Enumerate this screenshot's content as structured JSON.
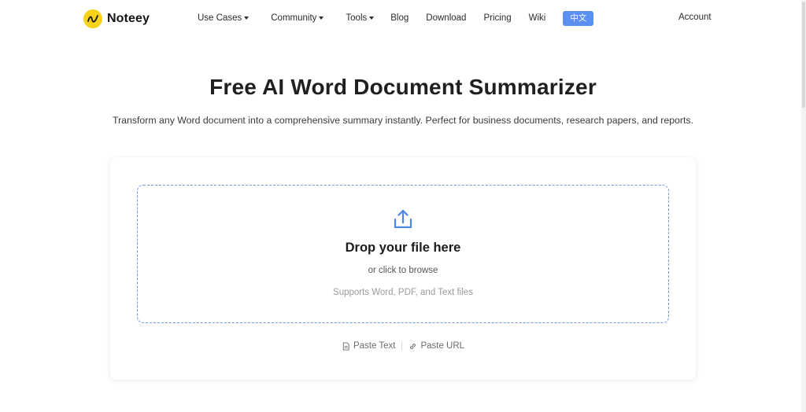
{
  "brand": {
    "name": "Noteey",
    "icon": "noteey-logo-icon",
    "color": "#f7d21a"
  },
  "nav": {
    "items": [
      {
        "label": "Use Cases",
        "dropdown": true
      },
      {
        "label": "Community",
        "dropdown": true
      },
      {
        "label": "Tools",
        "dropdown": true
      },
      {
        "label": "Blog",
        "dropdown": false
      },
      {
        "label": "Download",
        "dropdown": false
      },
      {
        "label": "Pricing",
        "dropdown": false
      },
      {
        "label": "Wiki",
        "dropdown": false
      }
    ],
    "language": "中文",
    "account": "Account"
  },
  "hero": {
    "title": "Free AI Word Document Summarizer",
    "subtitle": "Transform any Word document into a comprehensive summary instantly. Perfect for business documents, research papers, and reports."
  },
  "upload": {
    "icon": "upload-icon",
    "title": "Drop your file here",
    "browse": "or click to browse",
    "supports": "Supports Word, PDF, and Text files",
    "accent": "#4a86e8"
  },
  "actions": {
    "paste_text": "Paste Text",
    "paste_url": "Paste URL"
  }
}
